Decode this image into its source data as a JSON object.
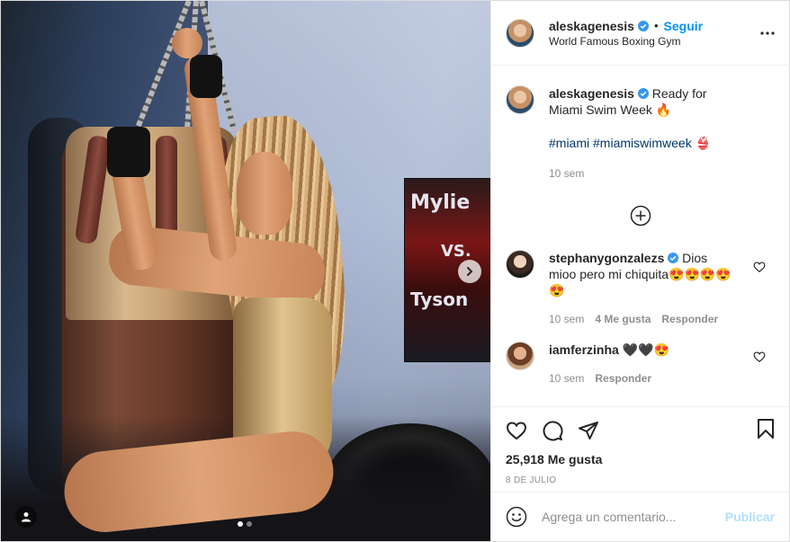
{
  "post": {
    "author": {
      "username": "aleskagenesis",
      "verified": true,
      "follow_label": "Seguir",
      "location": "World Famous Boxing Gym"
    },
    "caption": {
      "username": "aleskagenesis",
      "text": "Ready for Miami Swim Week 🔥",
      "hashtags": "#miami #miamiswimweek 👙",
      "time": "10 sem"
    },
    "comments": [
      {
        "username": "stephanygonzalezs",
        "verified": true,
        "text": "Dios mioo pero mi chiquita😍😍😍😍 😍",
        "time": "10 sem",
        "likes": "4 Me gusta",
        "reply_label": "Responder"
      },
      {
        "username": "iamferzinha",
        "verified": false,
        "text": "🖤🖤😍",
        "time": "10 sem",
        "reply_label": "Responder"
      }
    ],
    "likes": "25,918 Me gusta",
    "date": "8 DE JULIO",
    "compose": {
      "placeholder": "Agrega un comentario...",
      "publish_label": "Publicar"
    },
    "carousel": {
      "total": 2,
      "current": 1
    }
  },
  "colors": {
    "accent": "#0095f6",
    "publish_disabled": "#b2dffc",
    "hashtag": "#00376b",
    "muted": "#8e8e8e"
  },
  "icons": [
    "verified-badge-icon",
    "more-options-icon",
    "load-more-icon",
    "heart-icon",
    "comment-icon",
    "share-icon",
    "bookmark-icon",
    "emoji-icon",
    "tag-people-icon",
    "chevron-right-icon"
  ]
}
